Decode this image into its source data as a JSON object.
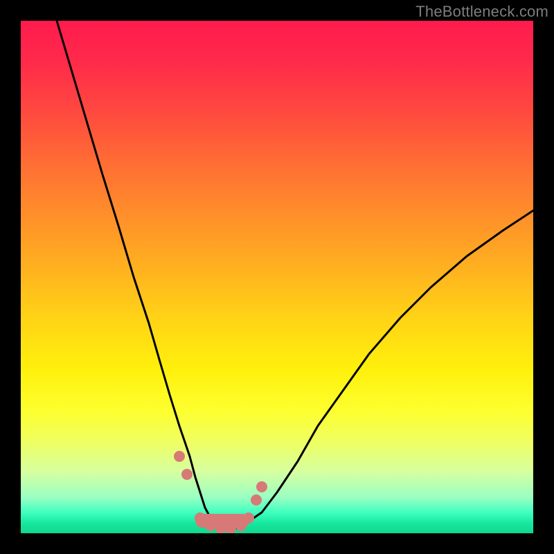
{
  "watermark": "TheBottleneck.com",
  "colors": {
    "frame": "#000000",
    "curve": "#000000",
    "marker": "#d77a77",
    "watermark": "#7d7d7d",
    "gradient_top": "#ff1b4d",
    "gradient_mid": "#ffd316",
    "gradient_bottom": "#0fd88f"
  },
  "chart_data": {
    "type": "line",
    "title": "",
    "xlabel": "",
    "ylabel": "",
    "xlim": [
      0,
      100
    ],
    "ylim": [
      0,
      100
    ],
    "note": "Axes are unlabeled in the source image; x/y are normalized to the plot area (0–100). y=0 is the bottom (green) edge, y=100 is the top (red) edge.",
    "series": [
      {
        "name": "bottleneck-curve",
        "x": [
          7,
          10,
          13,
          16,
          19,
          22,
          25,
          27,
          29,
          31,
          33,
          34,
          35,
          36,
          37,
          38,
          40,
          42,
          44,
          47,
          50,
          54,
          58,
          63,
          68,
          74,
          80,
          87,
          94,
          100
        ],
        "y": [
          100,
          90,
          80,
          70,
          60,
          50,
          41,
          34,
          27,
          21,
          15,
          11,
          8,
          5,
          3,
          2,
          1,
          1,
          2,
          4,
          8,
          14,
          21,
          28,
          35,
          42,
          48,
          54,
          59,
          63
        ]
      }
    ],
    "markers": {
      "name": "highlighted-points",
      "points": [
        {
          "x": 31.0,
          "y": 15.0
        },
        {
          "x": 32.5,
          "y": 11.5
        },
        {
          "x": 35.0,
          "y": 3.0
        },
        {
          "x": 37.0,
          "y": 1.5
        },
        {
          "x": 39.0,
          "y": 1.0
        },
        {
          "x": 41.0,
          "y": 1.0
        },
        {
          "x": 43.0,
          "y": 1.5
        },
        {
          "x": 44.5,
          "y": 3.0
        },
        {
          "x": 46.0,
          "y": 6.5
        },
        {
          "x": 47.0,
          "y": 9.0
        }
      ]
    }
  }
}
